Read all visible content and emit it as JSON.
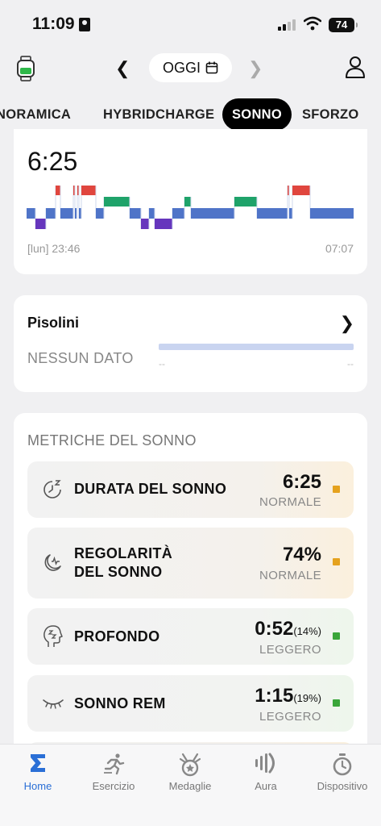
{
  "status_bar": {
    "time": "11:09",
    "battery": "74"
  },
  "header": {
    "date_label": "OGGI"
  },
  "tabs": [
    {
      "label": "NORAMICA",
      "active": false
    },
    {
      "label": "HYBRIDCHARGE",
      "active": false
    },
    {
      "label": "SONNO",
      "active": true
    },
    {
      "label": "SFORZO",
      "active": false
    }
  ],
  "sleep_card": {
    "duration": "6:25",
    "start_label": "[lun] 23:46",
    "end_label": "07:07",
    "colors": {
      "awake": "#e0463e",
      "rem": "#1fa36a",
      "light": "#4f74c8",
      "deep": "#6636bd"
    }
  },
  "naps": {
    "title": "Pisolini",
    "empty_text": "NESSUN DATO",
    "dash_left": "--",
    "dash_right": "--"
  },
  "metrics": {
    "title": "METRICHE DEL SONNO",
    "items": [
      {
        "label": "DURATA DEL SONNO",
        "value": "6:25",
        "pct": "",
        "status": "NORMALE",
        "color": "#e5a21e",
        "icon": "clock-zz-icon"
      },
      {
        "label_1": "REGOLARITÀ",
        "label_2": "DEL SONNO",
        "value": "74%",
        "pct": "",
        "status": "NORMALE",
        "color": "#e5a21e",
        "icon": "moon-pulse-icon"
      },
      {
        "label": "PROFONDO",
        "value": "0:52",
        "pct": "(14%)",
        "status": "LEGGERO",
        "color": "#3aa63a",
        "icon": "head-zz-icon"
      },
      {
        "label": "SONNO REM",
        "value": "1:15",
        "pct": "(19%)",
        "status": "LEGGERO",
        "color": "#3aa63a",
        "icon": "closed-eye-icon"
      }
    ]
  },
  "bottom_nav": [
    {
      "label": "Home",
      "icon": "sigma-home-icon",
      "active": true
    },
    {
      "label": "Esercizio",
      "icon": "runner-icon",
      "active": false
    },
    {
      "label": "Medaglie",
      "icon": "medal-icon",
      "active": false
    },
    {
      "label": "Aura",
      "icon": "aura-icon",
      "active": false
    },
    {
      "label": "Dispositivo",
      "icon": "stopwatch-icon",
      "active": false
    }
  ]
}
